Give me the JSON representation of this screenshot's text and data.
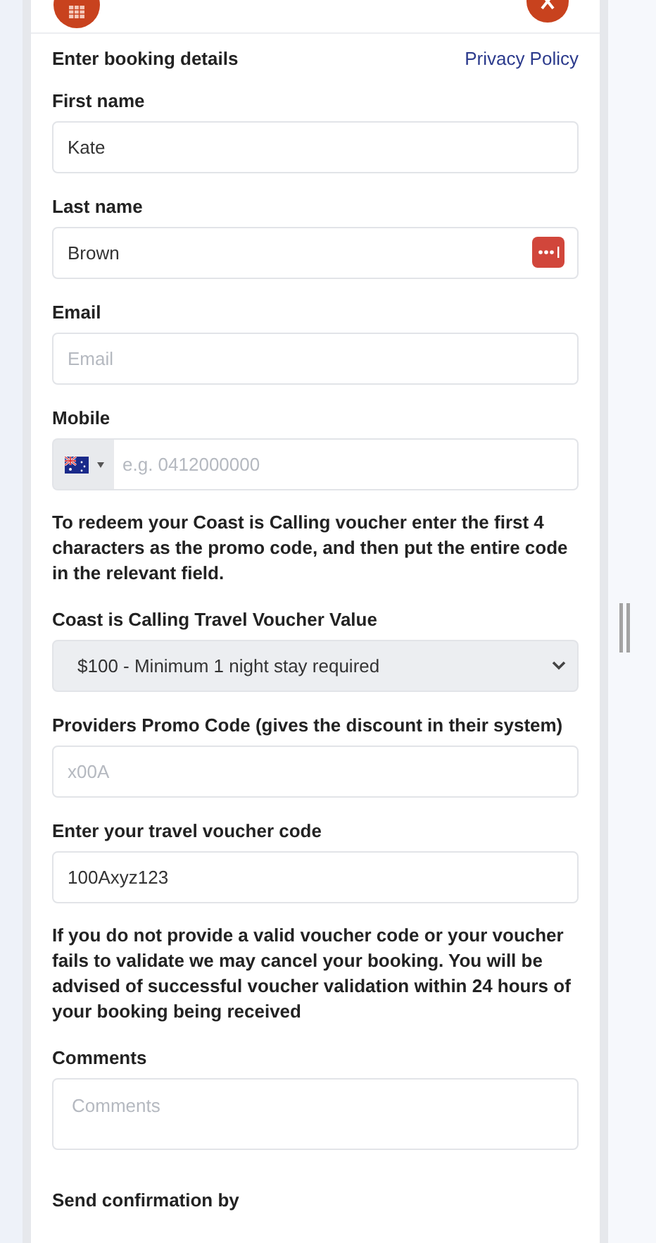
{
  "form": {
    "heading": "Enter booking details",
    "privacy_link": "Privacy Policy",
    "items": [
      {
        "kind": "input",
        "label": "First name",
        "value": "Kate"
      },
      {
        "kind": "input",
        "label": "Last name",
        "value": "Brown",
        "password_manager_icon": true
      },
      {
        "kind": "input",
        "label": "Email",
        "placeholder": "Email"
      },
      {
        "kind": "phone",
        "label": "Mobile",
        "placeholder": "e.g. 0412000000"
      },
      {
        "kind": "note",
        "text": "To redeem your Coast is Calling voucher enter the first 4 characters as the promo code, and then put the entire code in the relevant field."
      },
      {
        "kind": "select",
        "label": "Coast is Calling Travel Voucher Value",
        "value": "$100 - Minimum 1 night stay required"
      },
      {
        "kind": "input",
        "label": "Providers Promo Code (gives the discount in their system)",
        "placeholder": "x00A"
      },
      {
        "kind": "input",
        "label": "Enter your travel voucher code",
        "value": "100Axyz123"
      },
      {
        "kind": "note",
        "text": "If you do not provide a valid voucher code or your voucher fails to validate we may cancel your booking. You will be advised of successful voucher validation within 24 hours of your booking being received"
      },
      {
        "kind": "textarea",
        "label": "Comments",
        "placeholder": "Comments"
      },
      {
        "kind": "label",
        "label": "Send confirmation by"
      }
    ]
  }
}
